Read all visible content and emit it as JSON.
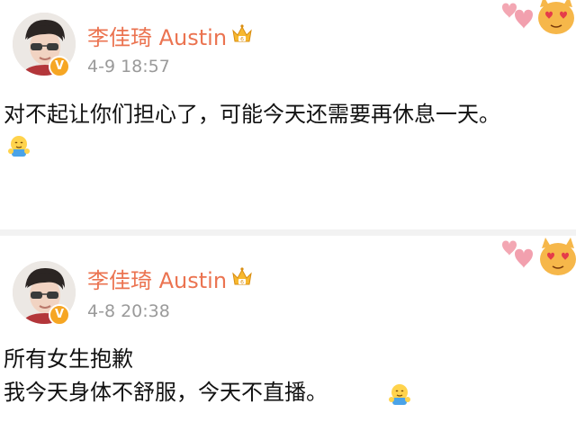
{
  "posts": [
    {
      "author": "李佳琦 Austin",
      "time": "4-9 18:57",
      "verified_mark": "V",
      "lines": [
        "对不起让你们担心了，可能今天还需要再休息一天。"
      ],
      "emoji": "hug-emoji"
    },
    {
      "author": "李佳琦 Austin",
      "time": "4-8 20:38",
      "verified_mark": "V",
      "lines": [
        "所有女生抱歉",
        "我今天身体不舒服，今天不直播。"
      ],
      "emoji": "hug-emoji"
    }
  ],
  "colors": {
    "author_name": "#eb7350",
    "timestamp": "#9a9a9a",
    "body_text": "#111111",
    "verified_badge": "#f6a623",
    "divider": "#f2f2f2"
  },
  "icons": [
    "avatar",
    "verified-badge-icon",
    "crown-vip-icon",
    "hug-emoji-icon",
    "hearts-cat-sticker"
  ]
}
